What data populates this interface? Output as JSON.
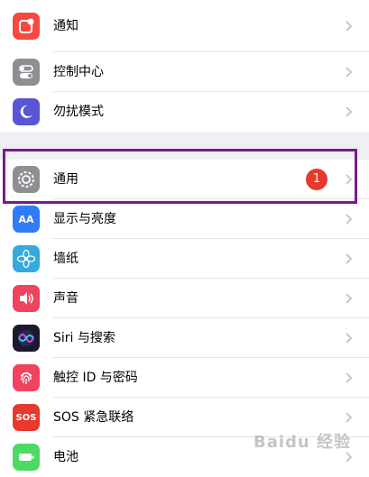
{
  "groups": [
    {
      "items": [
        {
          "label": "通知",
          "icon": "notification-icon",
          "color": "#f44a40"
        },
        {
          "label": "控制中心",
          "icon": "control-center-icon",
          "color": "#8e8e93"
        },
        {
          "label": "勿扰模式",
          "icon": "moon-icon",
          "color": "#5856d6"
        }
      ]
    },
    {
      "items": [
        {
          "label": "通用",
          "icon": "gear-icon",
          "color": "#8e8e93",
          "badge": "1"
        },
        {
          "label": "显示与亮度",
          "icon": "display-brightness-icon",
          "color": "#2f7cf6",
          "icon_text": "AA"
        },
        {
          "label": "墙纸",
          "icon": "wallpaper-flower-icon",
          "color": "#34aadc"
        },
        {
          "label": "声音",
          "icon": "speaker-icon",
          "color": "#f0435e"
        },
        {
          "label": "Siri 与搜索",
          "icon": "siri-icon",
          "color": "#1a1a2e"
        },
        {
          "label": "触控 ID 与密码",
          "icon": "fingerprint-icon",
          "color": "#f0435e"
        },
        {
          "label": "SOS 紧急联络",
          "icon": "sos-icon",
          "color": "#e8392d",
          "icon_text": "SOS"
        },
        {
          "label": "电池",
          "icon": "battery-icon",
          "color": "#4cd964"
        }
      ]
    }
  ],
  "highlight_color": "#7a1a8c",
  "watermark": "Baidu 经验"
}
